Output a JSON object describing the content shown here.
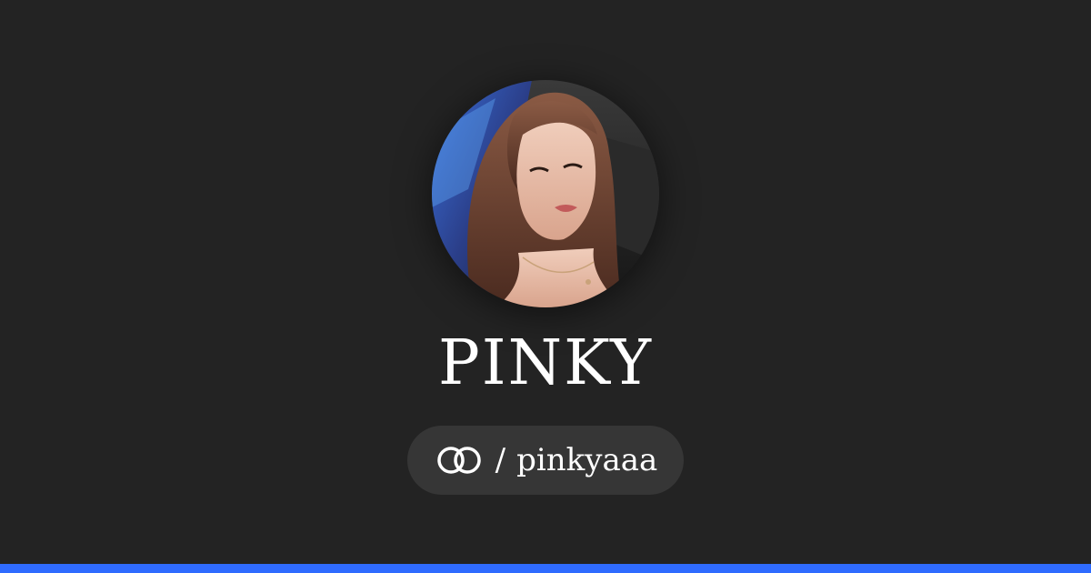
{
  "profile": {
    "display_name": "PINKY",
    "handle_separator": "/",
    "handle": "pinkyaaa",
    "avatar_icon": "profile-photo"
  },
  "brand": {
    "logo_icon": "linked-rings-icon",
    "accent_color": "#2f6bff",
    "background_color": "#232323",
    "pill_color": "#363636"
  }
}
